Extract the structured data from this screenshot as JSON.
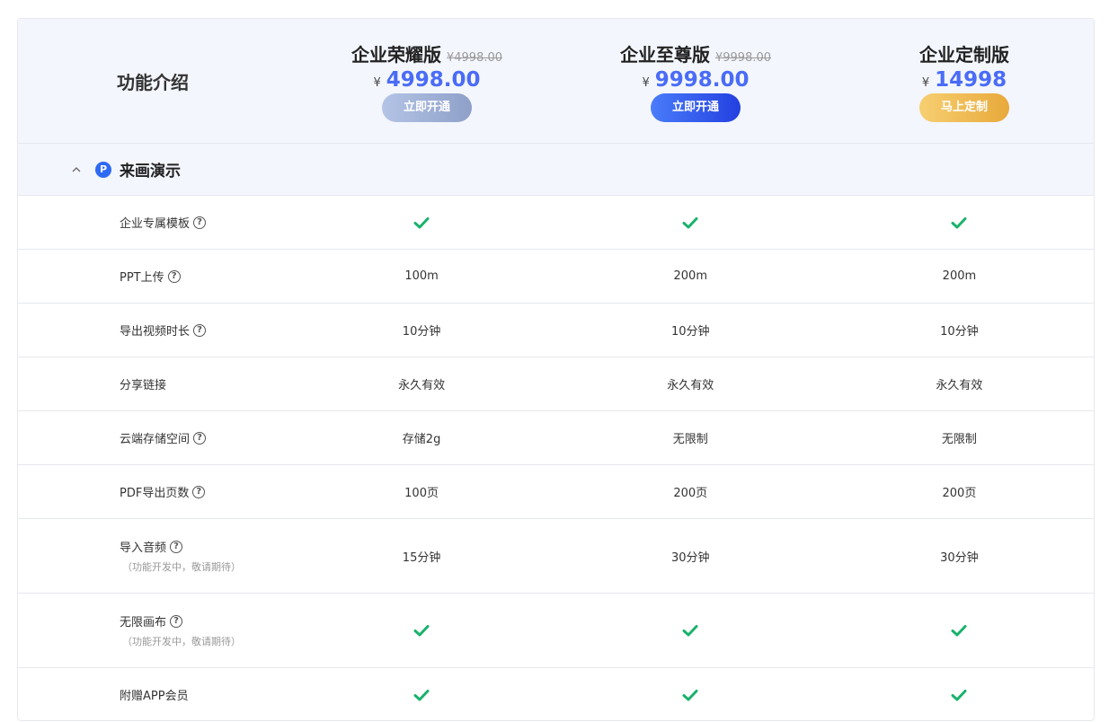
{
  "header": {
    "feature_title": "功能介绍",
    "plans": [
      {
        "name": "企业荣耀版",
        "original_price": "¥4998.00",
        "currency": "¥",
        "price": "4998.00",
        "button": "立即开通"
      },
      {
        "name": "企业至尊版",
        "original_price": "¥9998.00",
        "currency": "¥",
        "price": "9998.00",
        "button": "立即开通"
      },
      {
        "name": "企业定制版",
        "original_price": "",
        "currency": "¥",
        "price": "14998",
        "button": "马上定制"
      }
    ]
  },
  "section": {
    "title": "来画演示",
    "logo_letter": "P"
  },
  "rows": [
    {
      "feature": "企业专属模板",
      "note": "",
      "values": [
        "check",
        "check",
        "check"
      ]
    },
    {
      "feature": "PPT上传",
      "note": "",
      "values": [
        "100m",
        "200m",
        "200m"
      ]
    },
    {
      "feature": "导出视频时长",
      "note": "",
      "values": [
        "10分钟",
        "10分钟",
        "10分钟"
      ]
    },
    {
      "feature": "分享链接",
      "note": "",
      "values": [
        "永久有效",
        "永久有效",
        "永久有效"
      ]
    },
    {
      "feature": "云端存储空间",
      "note": "",
      "values": [
        "存储2g",
        "无限制",
        "无限制"
      ]
    },
    {
      "feature": "PDF导出页数",
      "note": "",
      "values": [
        "100页",
        "200页",
        "200页"
      ]
    },
    {
      "feature": "导入音频",
      "note": "（功能开发中，敬请期待）",
      "values": [
        "15分钟",
        "30分钟",
        "30分钟"
      ]
    },
    {
      "feature": "无限画布",
      "note": "（功能开发中，敬请期待）",
      "values": [
        "check",
        "check",
        "check"
      ]
    },
    {
      "feature": "附赠APP会员",
      "note": "",
      "values": [
        "check",
        "check",
        "check"
      ]
    }
  ],
  "help_glyph": "?",
  "colors": {
    "accent": "#4a6cf7",
    "check": "#19b26b",
    "header_bg": "#f3f6fd",
    "gold": "#e8a93a"
  }
}
